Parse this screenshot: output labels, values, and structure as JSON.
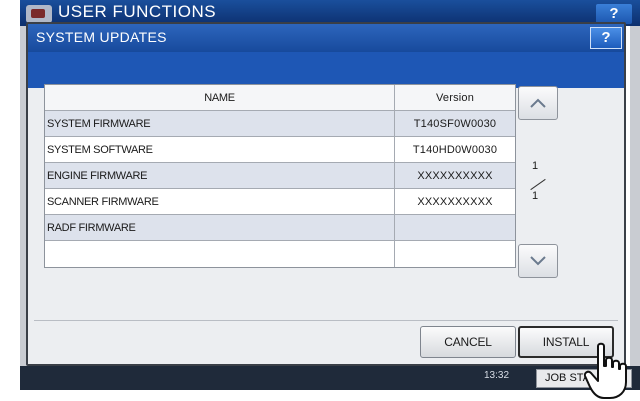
{
  "background": {
    "title": "USER FUNCTIONS",
    "help_label": "?",
    "clock": "13:32",
    "job_status_label": "JOB STA"
  },
  "dialog": {
    "title": "SYSTEM UPDATES",
    "help_label": "?"
  },
  "table": {
    "columns": [
      "NAME",
      "Version"
    ],
    "rows": [
      {
        "name": "SYSTEM FIRMWARE",
        "version": "T140SF0W0030"
      },
      {
        "name": "SYSTEM SOFTWARE",
        "version": "T140HD0W0030"
      },
      {
        "name": "ENGINE FIRMWARE",
        "version": "XXXXXXXXXX"
      },
      {
        "name": "SCANNER FIRMWARE",
        "version": "XXXXXXXXXX"
      },
      {
        "name": "RADF FIRMWARE",
        "version": ""
      },
      {
        "name": "",
        "version": ""
      }
    ]
  },
  "pager": {
    "current": "1",
    "total": "1"
  },
  "buttons": {
    "cancel": "CANCEL",
    "install": "INSTALL"
  },
  "icons": {
    "scroll_up": "chevron-up-icon",
    "scroll_down": "chevron-down-icon",
    "cursor": "hand-pointer-icon"
  },
  "colors": {
    "title_bar": "#1e57b5",
    "row_shade": "#dde2ec"
  }
}
